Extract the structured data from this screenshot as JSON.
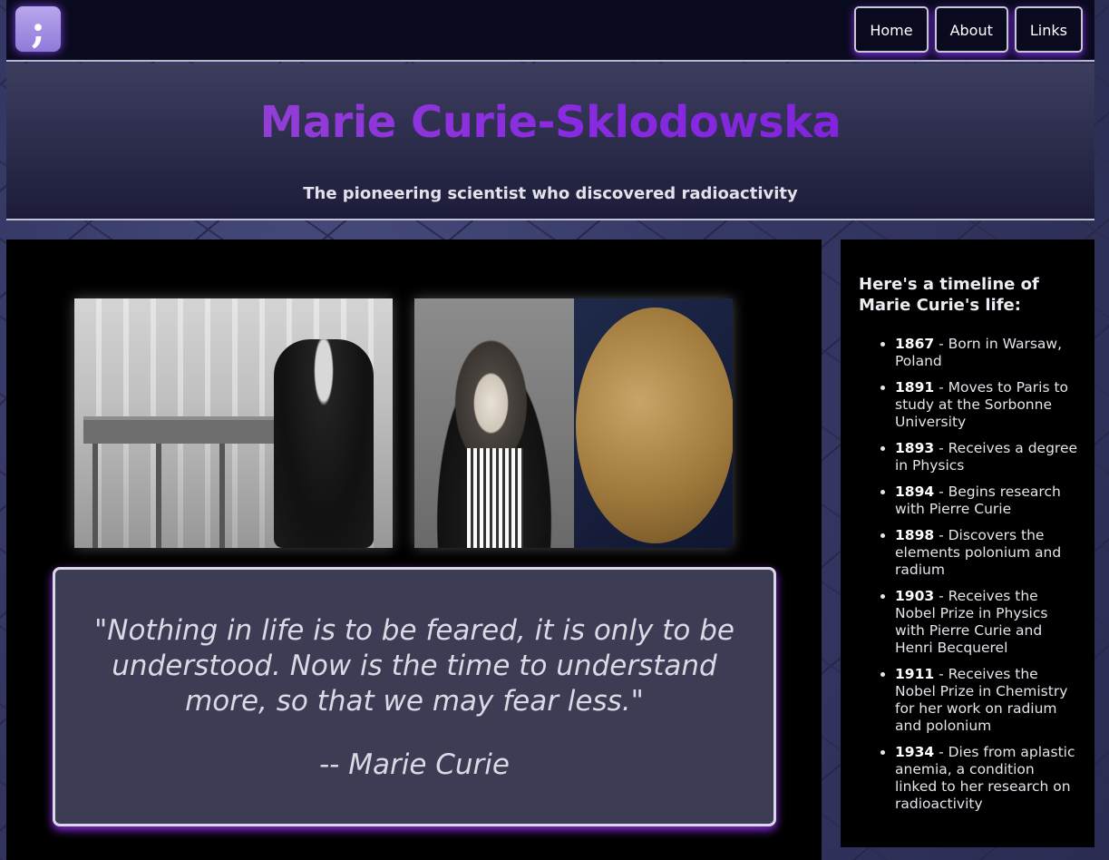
{
  "nav": {
    "logo_glyph": ";",
    "links": [
      "Home",
      "About",
      "Links"
    ]
  },
  "header": {
    "title": "Marie Curie-Sklodowska",
    "subtitle": "The pioneering scientist who discovered radioactivity"
  },
  "quote": {
    "text": "\"Nothing in life is to be feared, it is only to be understood. Now is the time to understand more, so that we may fear less.\"",
    "author": "-- Marie Curie"
  },
  "timeline": {
    "heading": "Here's a timeline of Marie Curie's life:",
    "items": [
      {
        "year": "1867",
        "text": " - Born in Warsaw, Poland"
      },
      {
        "year": "1891",
        "text": " - Moves to Paris to study at the Sorbonne University"
      },
      {
        "year": "1893",
        "text": " - Receives a degree in Physics"
      },
      {
        "year": "1894",
        "text": " - Begins research with Pierre Curie"
      },
      {
        "year": "1898",
        "text": " - Discovers the elements polonium and radium"
      },
      {
        "year": "1903",
        "text": " - Receives the Nobel Prize in Physics with Pierre Curie and Henri Becquerel"
      },
      {
        "year": "1911",
        "text": " - Receives the Nobel Prize in Chemistry for her work on radium and polonium"
      },
      {
        "year": "1934",
        "text": " - Dies from aplastic anemia, a condition linked to her research on radioactivity"
      }
    ]
  },
  "colors": {
    "title_gradient": [
      "#9a4ec9",
      "#8a2be2"
    ],
    "accent_glow": "#8a2be2"
  }
}
